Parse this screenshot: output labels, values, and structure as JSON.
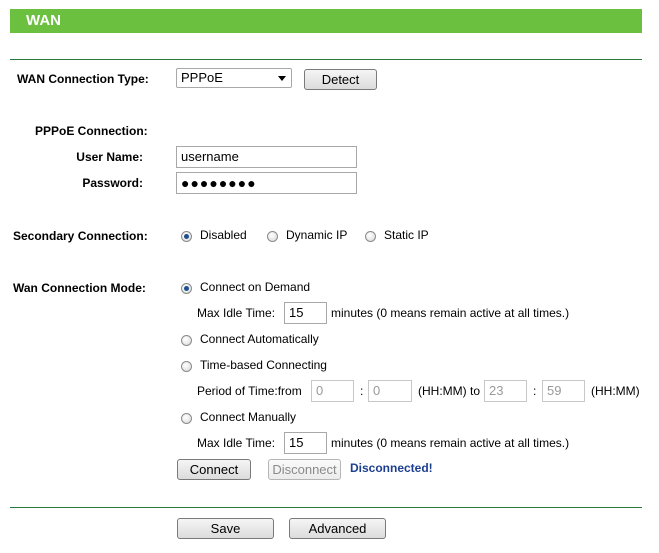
{
  "header": {
    "title": "WAN"
  },
  "wan_type": {
    "label": "WAN Connection Type:",
    "value": "PPPoE",
    "detect_label": "Detect"
  },
  "pppoe": {
    "section_label": "PPPoE Connection:",
    "username_label": "User Name:",
    "username_value": "username",
    "password_label": "Password:",
    "password_value": "●●●●●●●●"
  },
  "secondary": {
    "label": "Secondary Connection:",
    "options": [
      "Disabled",
      "Dynamic IP",
      "Static IP"
    ],
    "selected": "Disabled"
  },
  "mode": {
    "label": "Wan Connection Mode:",
    "on_demand": "Connect on Demand",
    "max_idle_label": "Max Idle Time:",
    "max_idle_value_1": "15",
    "idle_note": "minutes (0 means remain active at all times.)",
    "automatically": "Connect Automatically",
    "time_based": "Time-based Connecting",
    "period_label": "Period of Time:from",
    "from_h": "0",
    "sep1": ":",
    "from_m": "0",
    "hhmm_to": "(HH:MM) to",
    "to_h": "23",
    "sep2": ":",
    "to_m": "59",
    "hhmm_end": "(HH:MM)",
    "manually": "Connect Manually",
    "max_idle_value_2": "15",
    "selected": "Connect on Demand"
  },
  "actions": {
    "connect_label": "Connect",
    "disconnect_label": "Disconnect",
    "status_text": "Disconnected!"
  },
  "footer": {
    "save_label": "Save",
    "advanced_label": "Advanced"
  },
  "colors": {
    "header_bg": "#6cc040",
    "rule": "#2b7a3b",
    "status": "#1d3f8f",
    "radio_dot": "#1f4e8c"
  }
}
